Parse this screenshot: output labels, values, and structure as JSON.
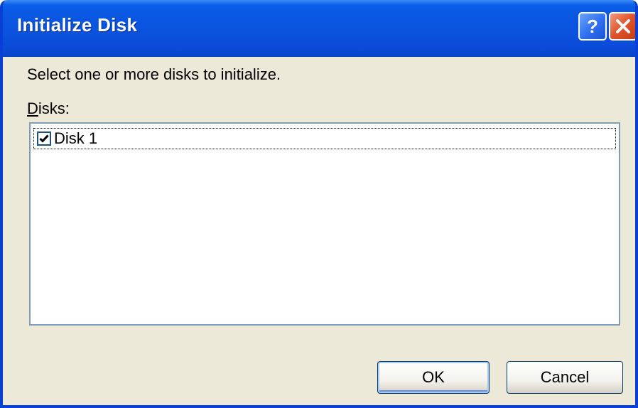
{
  "window": {
    "title": "Initialize Disk",
    "title_buttons": [
      "help-icon",
      "close-icon"
    ]
  },
  "dialog": {
    "instruction": "Select one or more disks to initialize.",
    "disks_label_accel": "D",
    "disks_label_rest": "isks:",
    "disks": [
      {
        "label": "Disk 1",
        "checked": true
      }
    ]
  },
  "buttons": {
    "ok_label": "OK",
    "cancel_label": "Cancel"
  },
  "colors": {
    "titlebar": "#0a58e2",
    "dialog_bg": "#ece9d8",
    "close_button": "#e2522a",
    "listbox_border": "#7f9db9"
  }
}
